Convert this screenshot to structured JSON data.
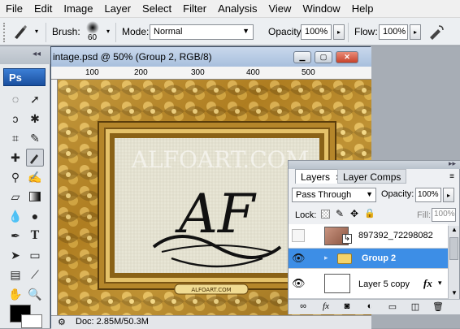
{
  "menu": [
    "File",
    "Edit",
    "Image",
    "Layer",
    "Select",
    "Filter",
    "Analysis",
    "View",
    "Window",
    "Help"
  ],
  "options_bar": {
    "brush_label": "Brush:",
    "brush_size": "60",
    "mode_label": "Mode:",
    "mode_value": "Normal",
    "opacity_label": "Opacity:",
    "opacity_value": "100%",
    "flow_label": "Flow:",
    "flow_value": "100%"
  },
  "tools_panel": {
    "logo": "Ps"
  },
  "document": {
    "title": "intage.psd @ 50% (Group 2, RGB/8)",
    "ruler_ticks": [
      "100",
      "200",
      "300",
      "400",
      "500"
    ],
    "watermark": "ALFOART.COM",
    "monogram": "AF",
    "plaque": "ALFOART.COM",
    "status": "Doc: 2.85M/50.3M"
  },
  "layers_panel": {
    "tabs": [
      "Layers",
      "Layer Comps"
    ],
    "blend_mode": "Pass Through",
    "opacity_label": "Opacity:",
    "opacity_value": "100%",
    "lock_label": "Lock:",
    "fill_label": "Fill:",
    "fill_value": "100%",
    "layers": [
      {
        "name": "897392_72298082",
        "visible": false,
        "selected": false,
        "type": "image"
      },
      {
        "name": "Group 2",
        "visible": true,
        "selected": true,
        "type": "group"
      },
      {
        "name": "Layer 5 copy",
        "visible": true,
        "selected": false,
        "type": "layer"
      }
    ]
  },
  "colors": {
    "accent": "#3d8ee6",
    "frame_gold": "#c99a2e",
    "canvas_inner": "#e9e7d8"
  }
}
